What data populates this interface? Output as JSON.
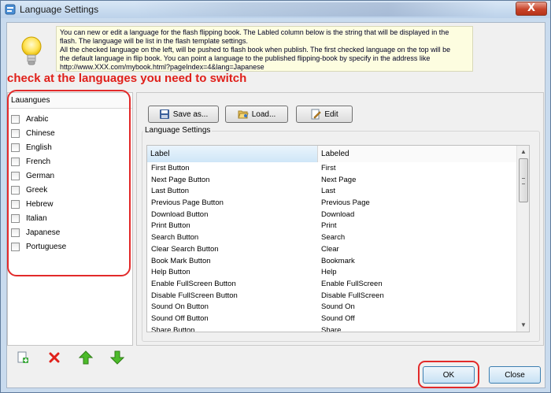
{
  "window": {
    "title": "Language Settings",
    "close_label": "X"
  },
  "info": {
    "lines": [
      "You can new or edit a language for the flash flipping book. The Labled column below is the string that will be displayed in the",
      "flash.  The language will be list in the flash template settings.",
      "All the checked language on the left, will be pushed to flash book when publish. The first checked language on the top will be",
      "the default language in flip book. You can point a language to the published flipping-book by  specify in the address like",
      "http://www.XXX.com/mybook.html?pageIndex=4&lang=Japanese"
    ]
  },
  "annotation": "check at the languages you need to switch",
  "languages": {
    "header": "Lauangues",
    "items": [
      "Arabic",
      "Chinese",
      "English",
      "French",
      "German",
      "Greek",
      "Hebrew",
      "Italian",
      "Japanese",
      "Portuguese"
    ]
  },
  "toolbar": {
    "save_label": "Save as...",
    "load_label": "Load...",
    "edit_label": "Edit"
  },
  "group_label": "Language Settings",
  "grid": {
    "headers": [
      "Label",
      "Labeled"
    ],
    "rows": [
      [
        "First Button",
        "First"
      ],
      [
        "Next Page Button",
        "Next Page"
      ],
      [
        "Last Button",
        "Last"
      ],
      [
        "Previous Page Button",
        "Previous Page"
      ],
      [
        "Download Button",
        "Download"
      ],
      [
        "Print Button",
        "Print"
      ],
      [
        "Search Button",
        "Search"
      ],
      [
        "Clear Search Button",
        "Clear"
      ],
      [
        "Book Mark Button",
        "Bookmark"
      ],
      [
        "Help Button",
        "Help"
      ],
      [
        "Enable FullScreen Button",
        "Enable FullScreen"
      ],
      [
        "Disable FullScreen Button",
        "Disable FullScreen"
      ],
      [
        "Sound On Button",
        "Sound On"
      ],
      [
        "Sound Off Button",
        "Sound Off"
      ],
      [
        "Share Button",
        "Share"
      ]
    ]
  },
  "dialog": {
    "ok_label": "OK",
    "close_label": "Close"
  },
  "colors": {
    "annotation_red": "#e22a2a",
    "info_bg": "#fdfde0",
    "accent_blue": "#3c7fb1"
  }
}
